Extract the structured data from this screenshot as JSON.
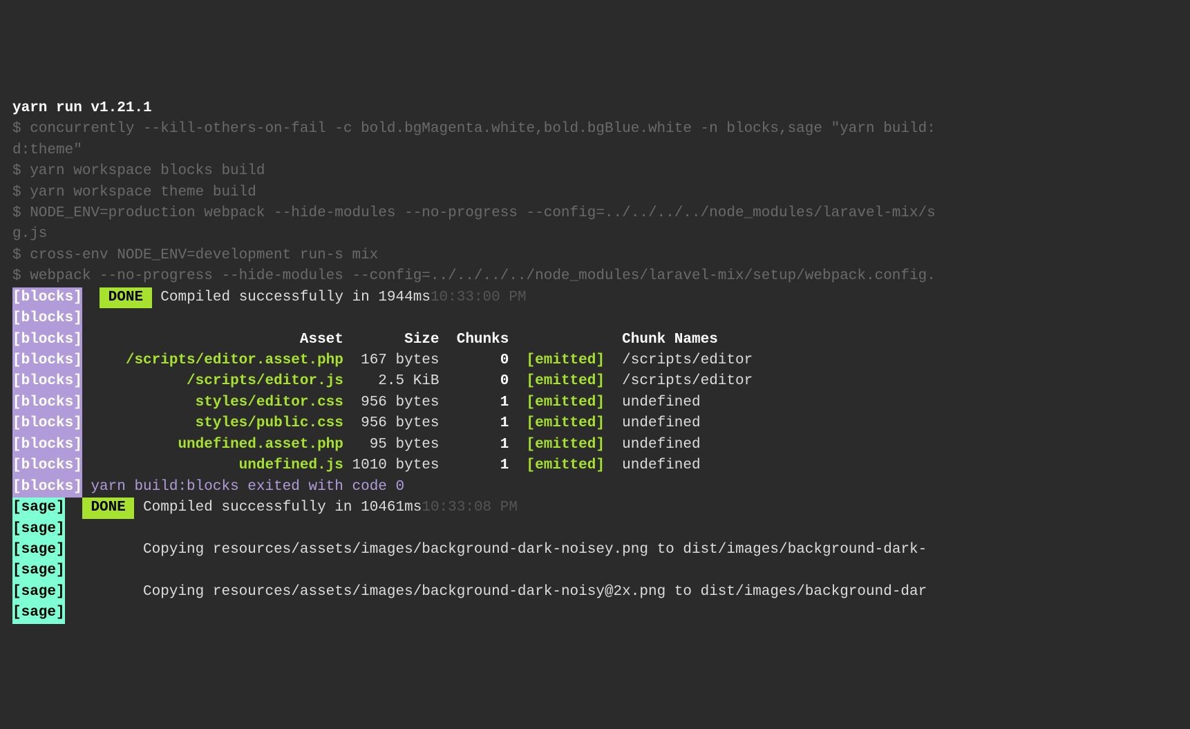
{
  "header": "yarn run v1.21.1",
  "cmd1": "$ concurrently --kill-others-on-fail -c bold.bgMagenta.white,bold.bgBlue.white -n blocks,sage \"yarn build:",
  "cmd1b": "d:theme\"",
  "cmd2": "$ yarn workspace blocks build",
  "cmd3": "$ yarn workspace theme build",
  "cmd4": "$ NODE_ENV=production webpack --hide-modules --no-progress --config=../../../../node_modules/laravel-mix/s",
  "cmd4b": "g.js",
  "cmd5": "$ cross-env NODE_ENV=development run-s mix",
  "cmd6": "$ webpack --no-progress --hide-modules --config=../../../../node_modules/laravel-mix/setup/webpack.config.",
  "tags": {
    "blocks": "[blocks]",
    "sage": "[sage]"
  },
  "done": " DONE ",
  "blocks_done_msg": " Compiled successfully in 1944ms",
  "blocks_done_time": "10:33:00 PM",
  "table": {
    "headers": {
      "asset": "Asset",
      "size": "Size",
      "chunks": "Chunks",
      "chunk_names": "Chunk Names"
    },
    "rows": [
      {
        "asset": "/scripts/editor.asset.php",
        "size": "167 bytes",
        "chunks": "0",
        "emitted": "[emitted]",
        "chunk_names": "/scripts/editor"
      },
      {
        "asset": "/scripts/editor.js",
        "size": "2.5 KiB",
        "chunks": "0",
        "emitted": "[emitted]",
        "chunk_names": "/scripts/editor"
      },
      {
        "asset": "styles/editor.css",
        "size": "956 bytes",
        "chunks": "1",
        "emitted": "[emitted]",
        "chunk_names": "undefined"
      },
      {
        "asset": "styles/public.css",
        "size": "956 bytes",
        "chunks": "1",
        "emitted": "[emitted]",
        "chunk_names": "undefined"
      },
      {
        "asset": "undefined.asset.php",
        "size": "95 bytes",
        "chunks": "1",
        "emitted": "[emitted]",
        "chunk_names": "undefined"
      },
      {
        "asset": "undefined.js",
        "size": "1010 bytes",
        "chunks": "1",
        "emitted": "[emitted]",
        "chunk_names": "undefined"
      }
    ]
  },
  "blocks_exit": " yarn build:blocks exited with code 0",
  "sage_done_msg": " Compiled successfully in 10461ms",
  "sage_done_time": "10:33:08 PM",
  "sage_copy1": "         Copying resources/assets/images/background-dark-noisey.png to dist/images/background-dark-",
  "sage_copy2": "         Copying resources/assets/images/background-dark-noisy@2x.png to dist/images/background-dar"
}
